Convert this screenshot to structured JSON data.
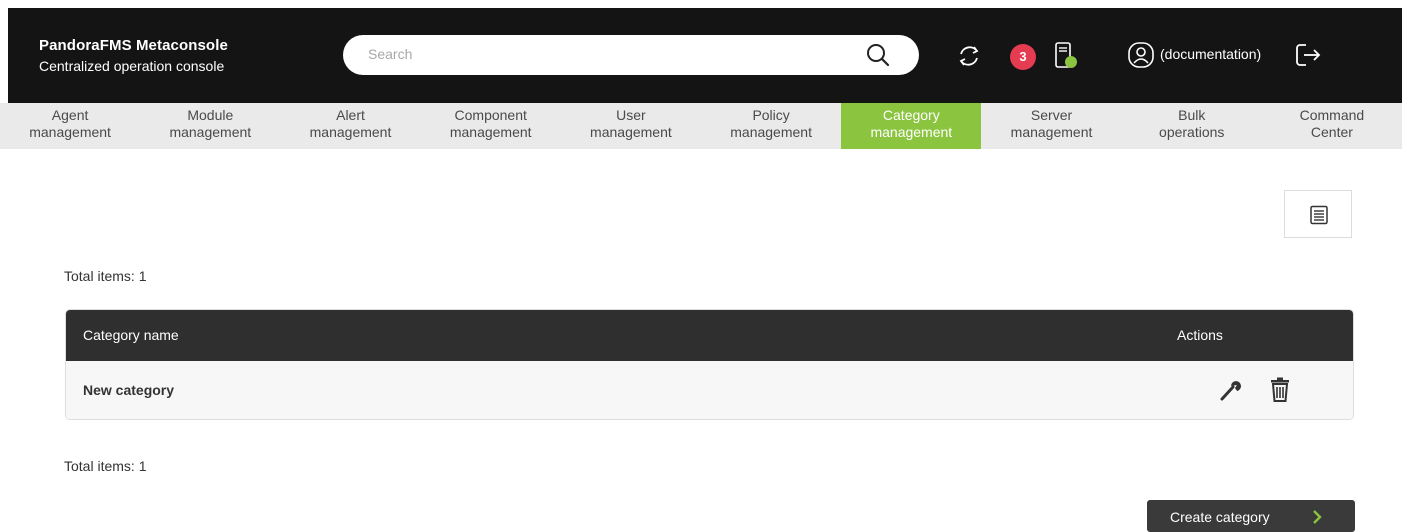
{
  "header": {
    "title": "PandoraFMS Metaconsole",
    "subtitle": "Centralized operation console",
    "search_placeholder": "Search",
    "notifications_count": "3",
    "user_label": "(documentation)"
  },
  "nav": {
    "items": [
      {
        "line1": "Agent",
        "line2": "management"
      },
      {
        "line1": "Module",
        "line2": "management"
      },
      {
        "line1": "Alert",
        "line2": "management"
      },
      {
        "line1": "Component",
        "line2": "management"
      },
      {
        "line1": "User",
        "line2": "management"
      },
      {
        "line1": "Policy",
        "line2": "management"
      },
      {
        "line1": "Category",
        "line2": "management"
      },
      {
        "line1": "Server",
        "line2": "management"
      },
      {
        "line1": "Bulk",
        "line2": "operations"
      },
      {
        "line1": "Command",
        "line2": "Center"
      }
    ],
    "active_index": 6
  },
  "content": {
    "total_top": "Total items: 1",
    "total_bottom": "Total items: 1",
    "table": {
      "columns": [
        "Category name",
        "Actions"
      ],
      "rows": [
        {
          "name": "New category"
        }
      ]
    },
    "create_button_label": "Create category"
  },
  "colors": {
    "header_bg": "#141414",
    "nav_bg": "#eaeaea",
    "accent": "#8bc43f",
    "badge": "#e63c52"
  },
  "icons": [
    "search-icon",
    "refresh-icon",
    "server-status-icon",
    "user-icon",
    "logout-icon",
    "list-view-icon",
    "wrench-icon",
    "trash-icon",
    "chevron-right-icon"
  ]
}
